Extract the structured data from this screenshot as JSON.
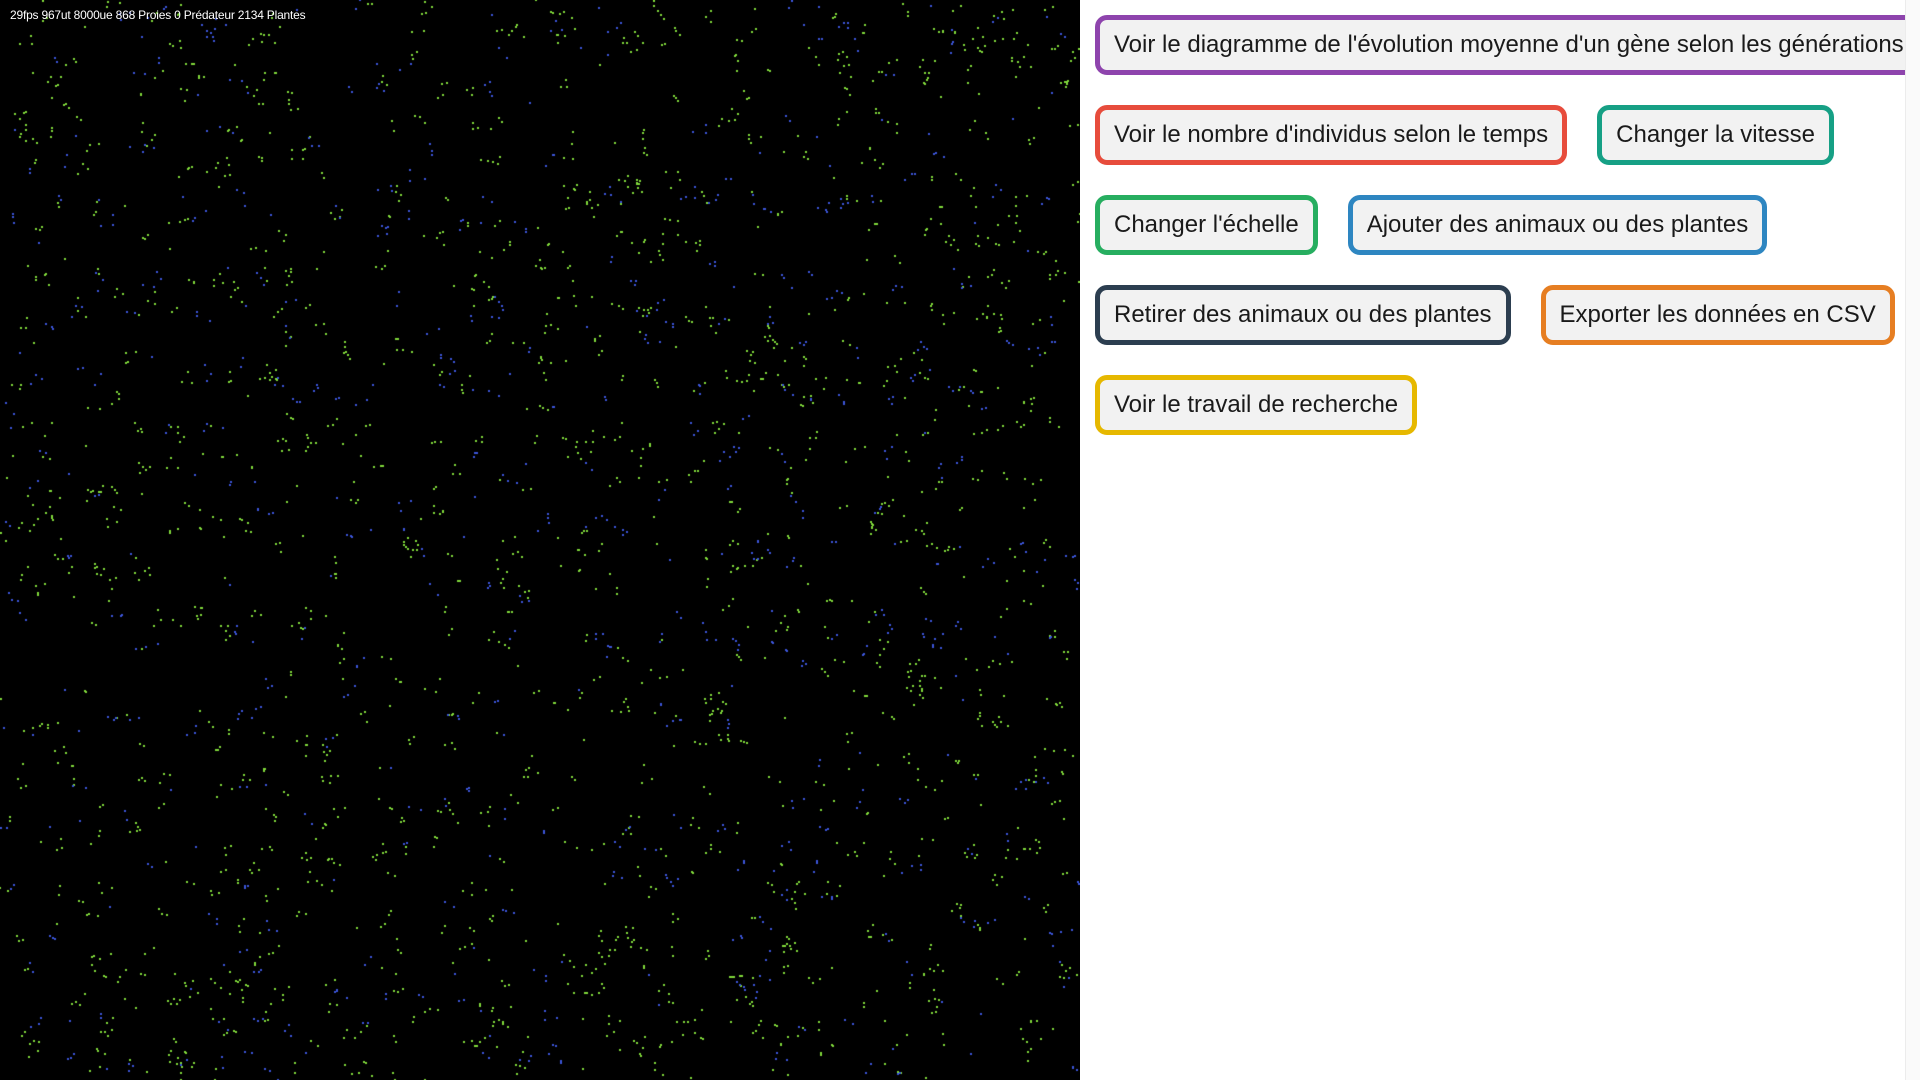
{
  "simulation": {
    "stats_text": "29fps 967ut 8000ue 868 Proies 0 Prédateur 2134 Plantes",
    "background_color": "#000000",
    "dot_colors": {
      "plants": "#7fd83a",
      "prey": "#3b55d8"
    }
  },
  "buttons": [
    {
      "label": "Voir le diagramme de l'évolution moyenne d'un gène selon les générations",
      "color": "#8e44ad"
    },
    {
      "label": "Voir le nombre d'individus selon le temps",
      "color": "#e74c3c"
    },
    {
      "label": "Changer la vitesse",
      "color": "#16a085"
    },
    {
      "label": "Changer l'échelle",
      "color": "#27ae60"
    },
    {
      "label": "Ajouter des animaux ou des plantes",
      "color": "#2e86c1"
    },
    {
      "label": "Retirer des animaux ou des plantes",
      "color": "#2c3e50"
    },
    {
      "label": "Exporter les données en CSV",
      "color": "#e67e22"
    },
    {
      "label": "Voir le travail de recherche",
      "color": "#e6b800"
    }
  ]
}
